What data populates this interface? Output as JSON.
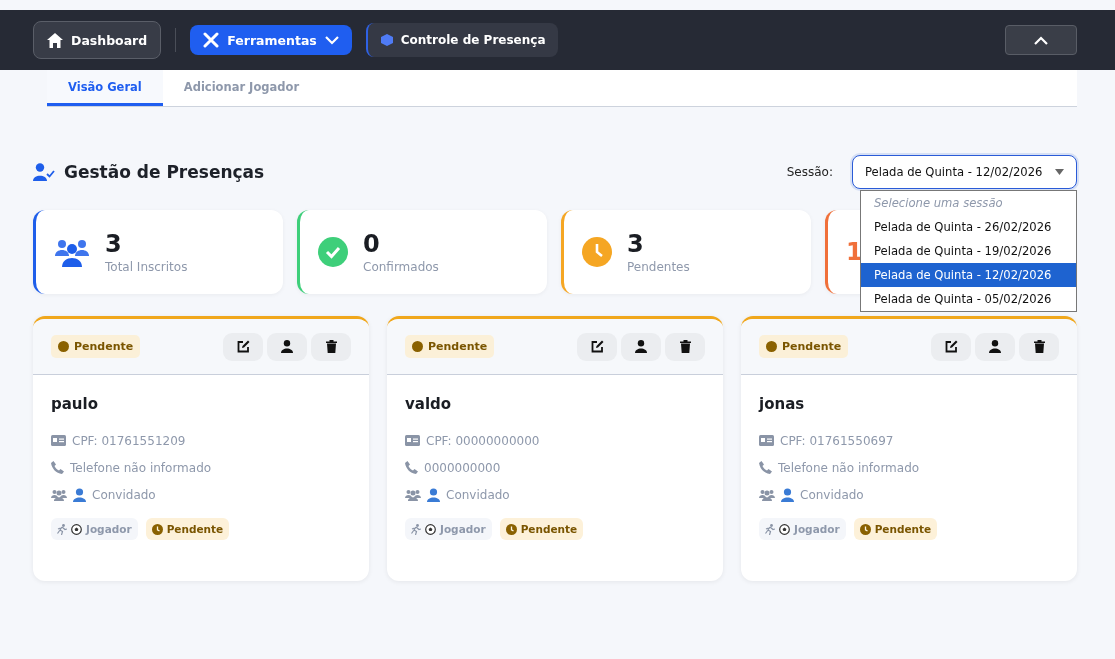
{
  "nav": {
    "dashboard": "Dashboard",
    "tools": "Ferramentas",
    "current": "Controle de Presença"
  },
  "tabs": [
    {
      "label": "Visão Geral",
      "selected": true
    },
    {
      "label": "Adicionar Jogador",
      "selected": false
    }
  ],
  "title": "Gestão de Presenças",
  "session": {
    "label": "Sessão:",
    "value": "Pelada de Quinta - 12/02/2026",
    "expanded": true,
    "placeholder": "Selecione uma sessão",
    "options": [
      {
        "label": "Pelada de Quinta - 26/02/2026",
        "selected": false
      },
      {
        "label": "Pelada de Quinta - 19/02/2026",
        "selected": false
      },
      {
        "label": "Pelada de Quinta - 12/02/2026",
        "selected": true
      },
      {
        "label": "Pelada de Quinta - 05/02/2026",
        "selected": false
      }
    ]
  },
  "stats": [
    {
      "kind": "users",
      "value": "3",
      "label": "Total Inscritos",
      "color": "#1e5eea"
    },
    {
      "kind": "check",
      "value": "0",
      "label": "Confirmados",
      "color": "#3ecf7a"
    },
    {
      "kind": "clock",
      "value": "3",
      "label": "Pendentes",
      "color": "#f5a623"
    },
    {
      "kind": "other",
      "value": "1",
      "color": "#f0703a"
    }
  ],
  "players": [
    {
      "status": "Pendente",
      "name": "paulo",
      "cpf": "CPF: 01761551209",
      "phone": "Telefone não informado",
      "group": "Convidado",
      "role": "Jogador",
      "tag": "Pendente"
    },
    {
      "status": "Pendente",
      "name": "valdo",
      "cpf": "CPF: 00000000000",
      "phone": "0000000000",
      "group": "Convidado",
      "role": "Jogador",
      "tag": "Pendente"
    },
    {
      "status": "Pendente",
      "name": "jonas",
      "cpf": "CPF: 01761550697",
      "phone": "Telefone não informado",
      "group": "Convidado",
      "role": "Jogador",
      "tag": "Pendente"
    }
  ]
}
